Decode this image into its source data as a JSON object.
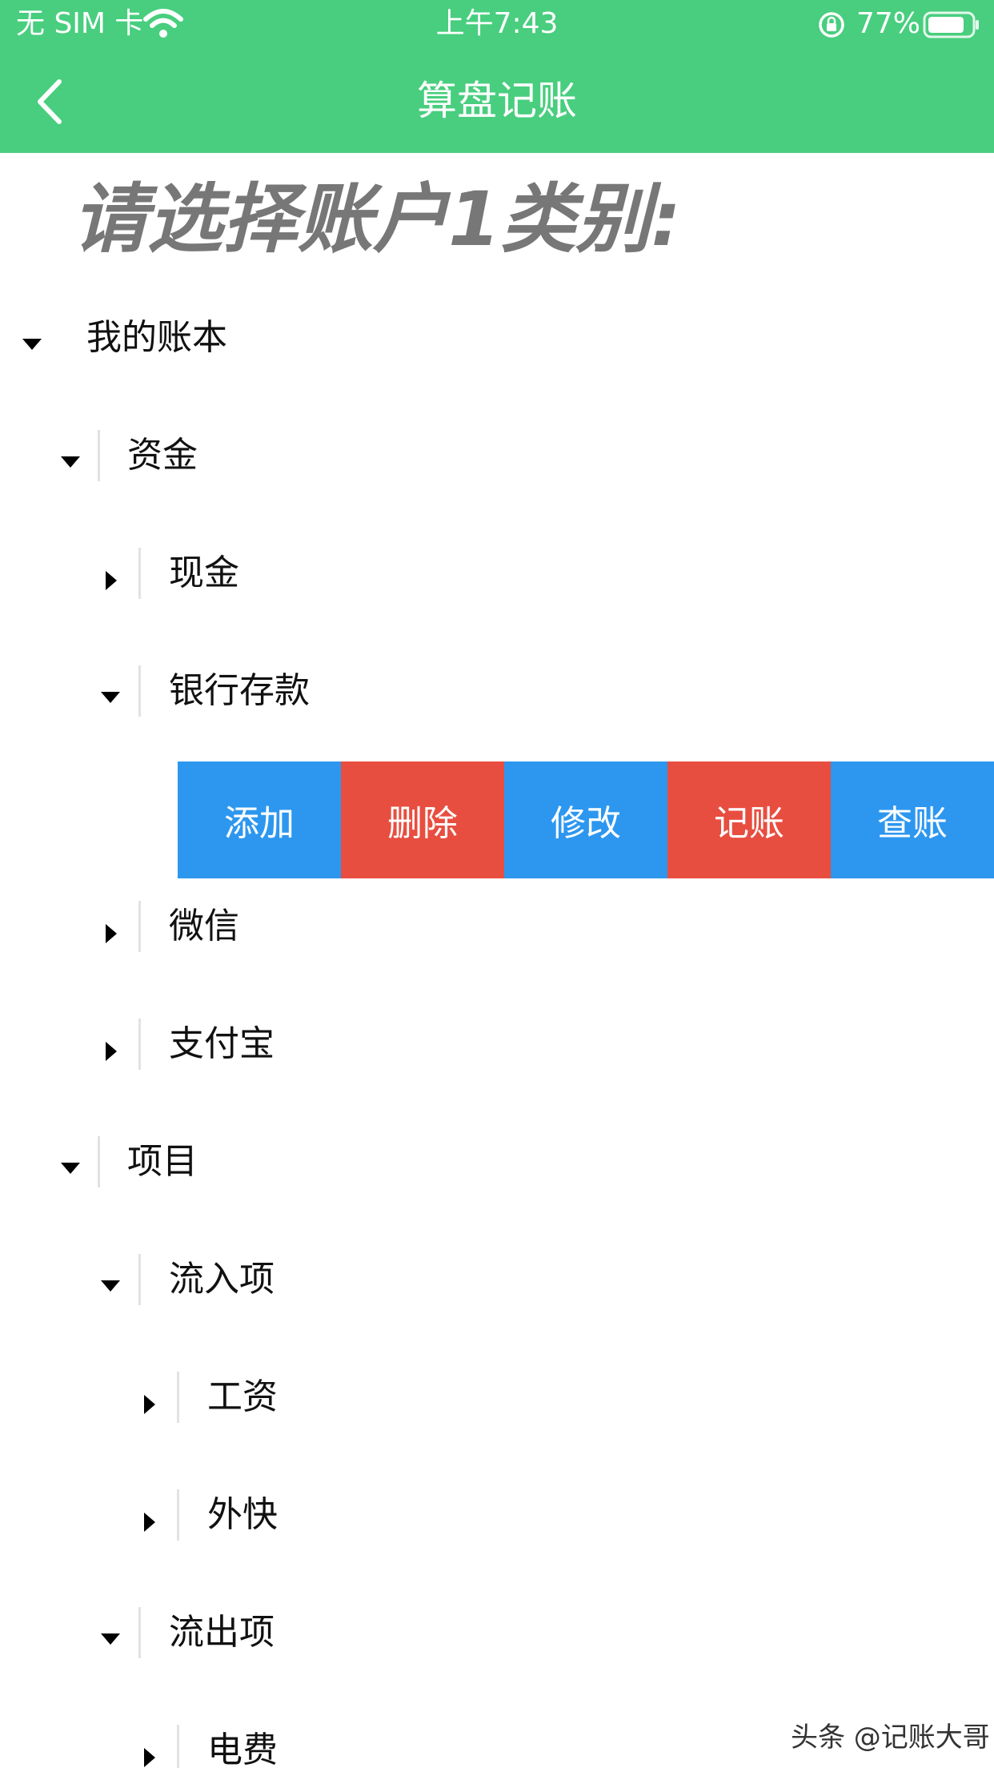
{
  "status_bar": {
    "carrier": "无 SIM 卡",
    "time": "上午7:43",
    "battery": "77%"
  },
  "nav": {
    "title": "算盘记账",
    "back_icon": "chevron-left-icon"
  },
  "heading": "请选择账户1类别:",
  "tree": {
    "root": "我的账本",
    "funds": "资金",
    "cash": "现金",
    "bank": "银行存款",
    "wechat": "微信",
    "alipay": "支付宝",
    "project": "项目",
    "inflow": "流入项",
    "salary": "工资",
    "side_income": "外快",
    "outflow": "流出项",
    "electricity": "电费"
  },
  "actions": {
    "add": "添加",
    "delete": "删除",
    "edit": "修改",
    "record": "记账",
    "query": "查账"
  },
  "colors": {
    "header_green": "#48ce7e",
    "action_blue": "#2d97ef",
    "action_red": "#e84e40",
    "heading_gray": "#777777"
  },
  "watermark": "头条 @记账大哥"
}
